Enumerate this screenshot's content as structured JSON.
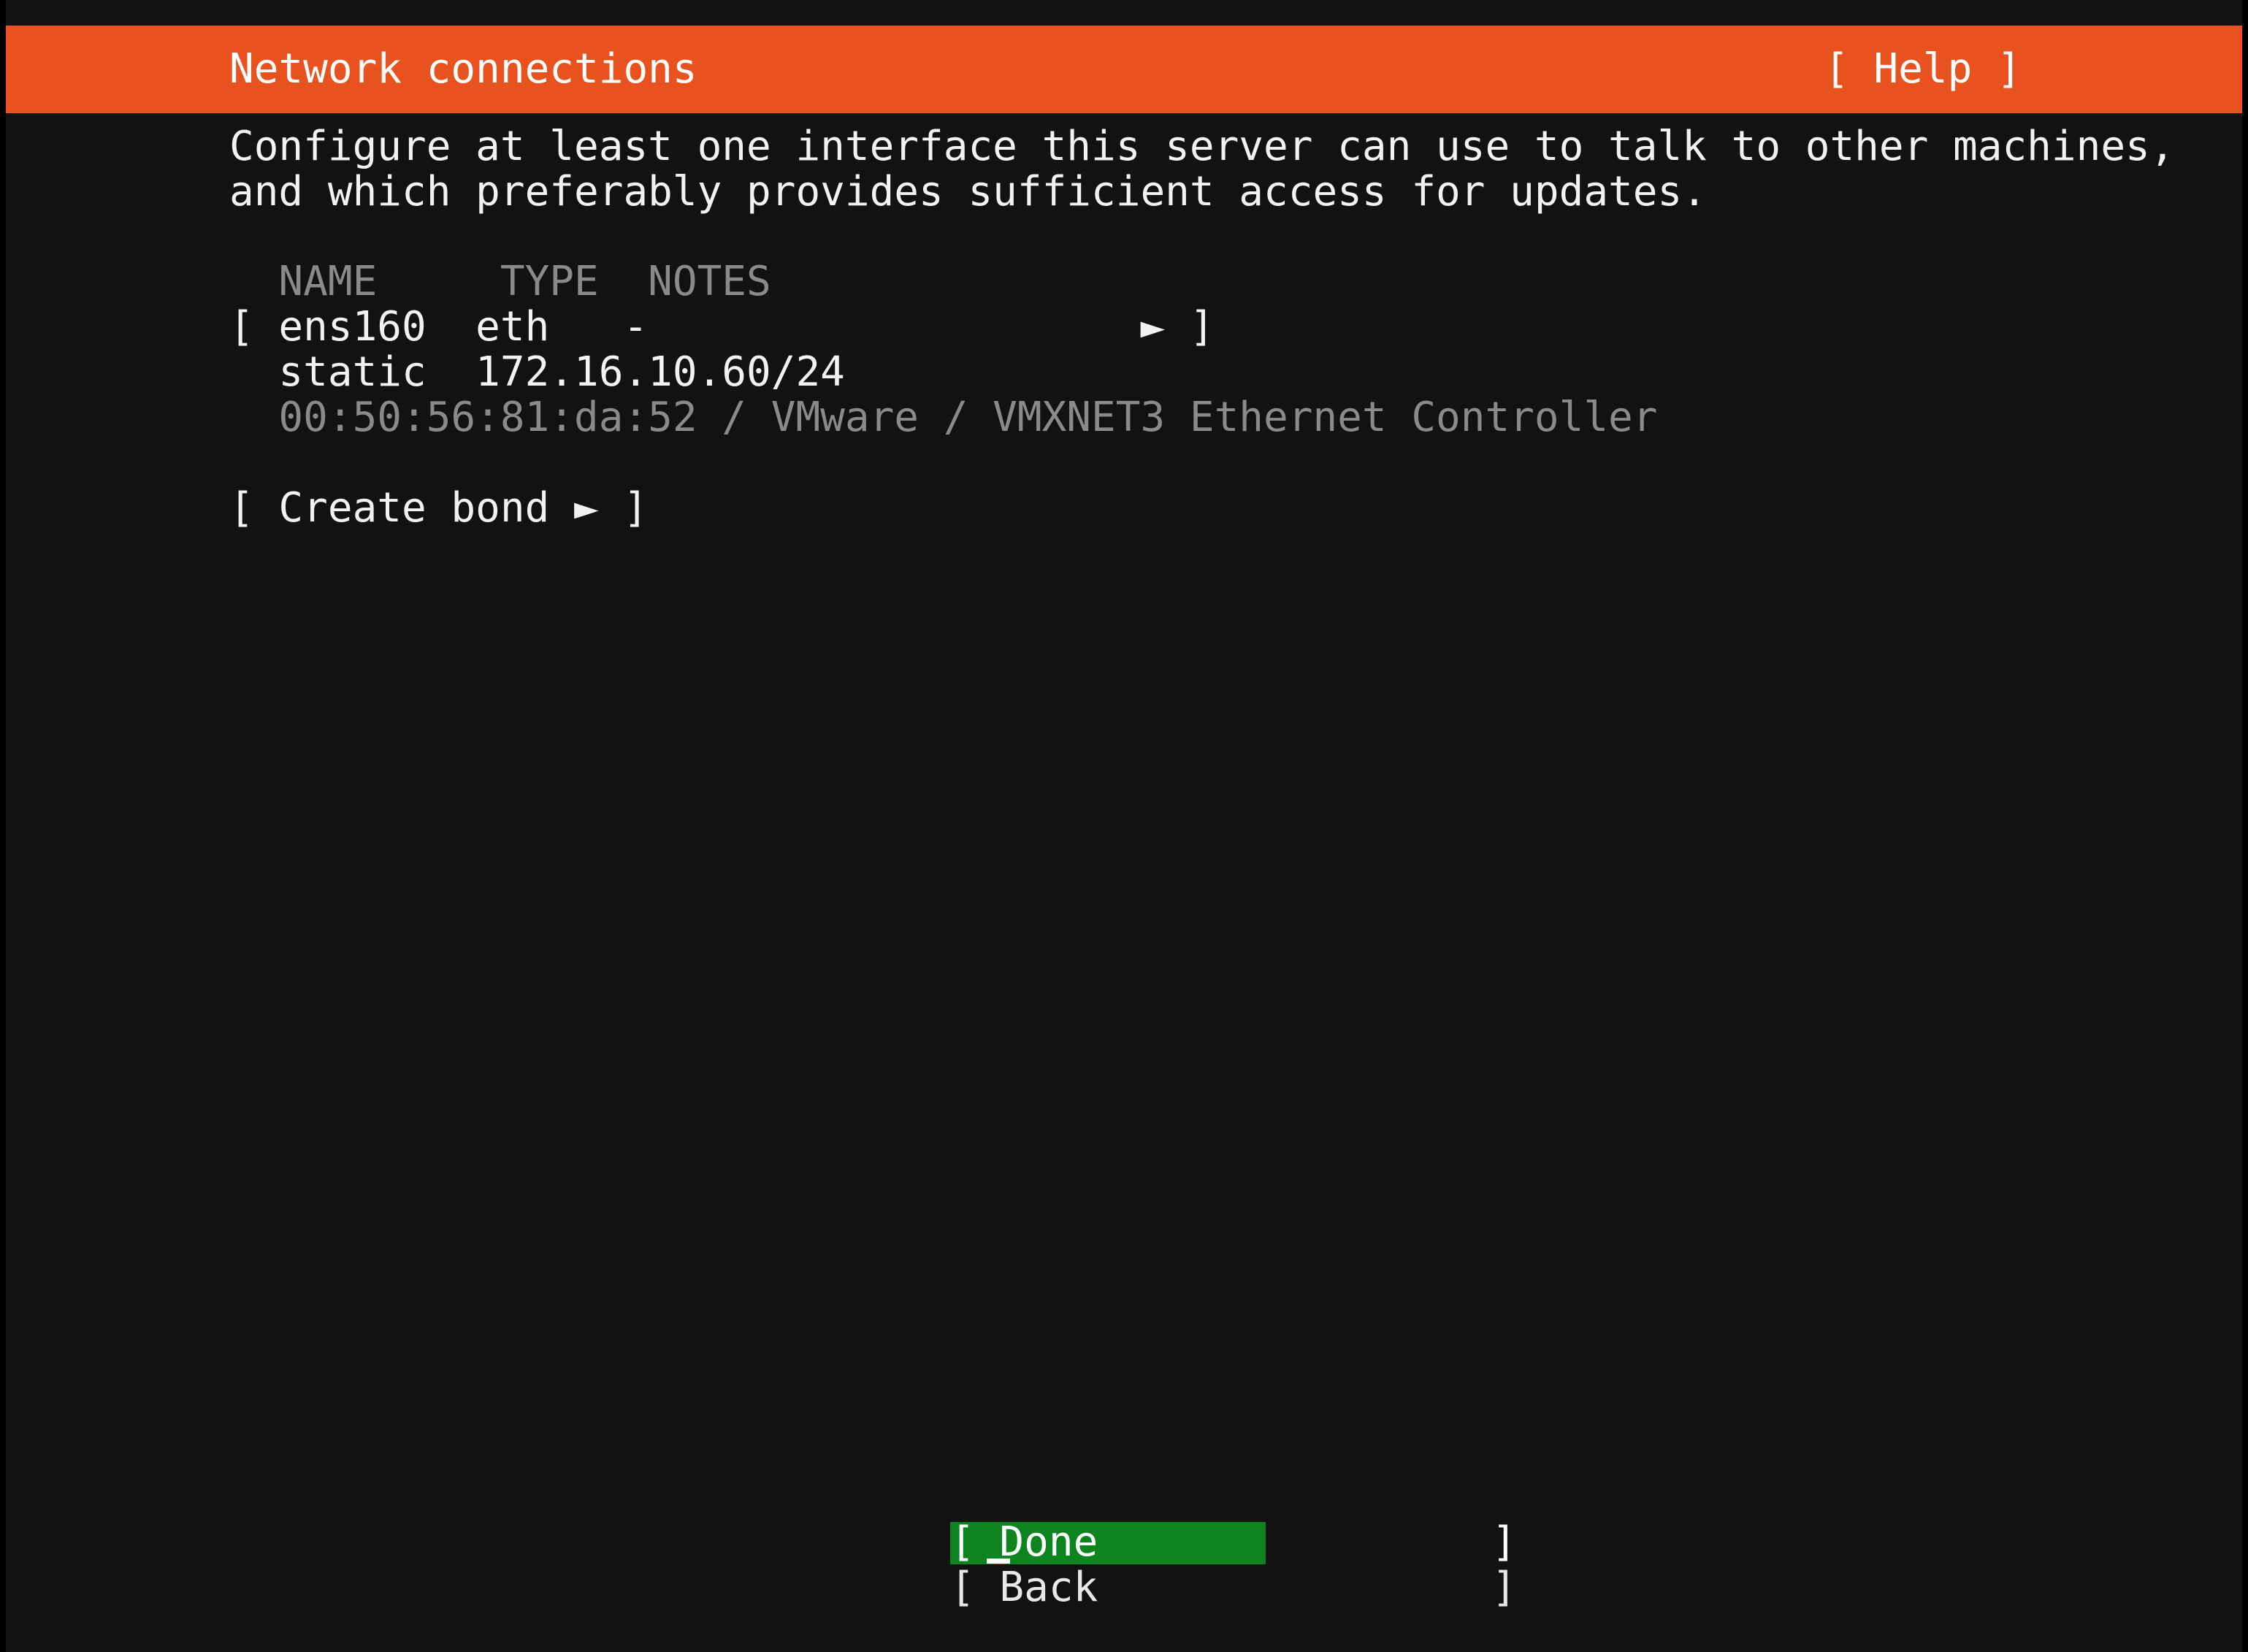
{
  "header": {
    "title": "Network connections",
    "help_label": "[ Help ]",
    "background_color": "#e8521e",
    "text_color": "#ffffff"
  },
  "description": {
    "line1": "Configure at least one interface this server can use to talk to other machines,",
    "line2": "and which preferably provides sufficient access for updates."
  },
  "interfaces_table": {
    "header_row": "  NAME     TYPE  NOTES",
    "columns": [
      "NAME",
      "TYPE",
      "NOTES"
    ],
    "rows": [
      {
        "selector_line": "[ ens160  eth   -                    ► ]",
        "name": "ens160",
        "type": "eth",
        "notes": "-",
        "expand_marker": "►",
        "address_line": "  static  172.16.10.60/24",
        "address_mode": "static",
        "address": "172.16.10.60/24",
        "meta_line": "  00:50:56:81:da:52 / VMware / VMXNET3 Ethernet Controller",
        "mac": "00:50:56:81:da:52",
        "vendor": "VMware",
        "model": "VMXNET3 Ethernet Controller"
      }
    ]
  },
  "actions": {
    "create_bond": "[ Create bond ► ]"
  },
  "footer": {
    "done_label": "[ Done                ]",
    "back_label": "[ Back                ]",
    "done_selected": true,
    "done_background_color": "#0e8420"
  },
  "colors": {
    "terminal_background": "#121212",
    "frame": "#000000",
    "foreground": "#e8e8e8",
    "dim_foreground": "#8a8a8a",
    "accent_orange": "#e8521e",
    "accent_green": "#0e8420"
  }
}
